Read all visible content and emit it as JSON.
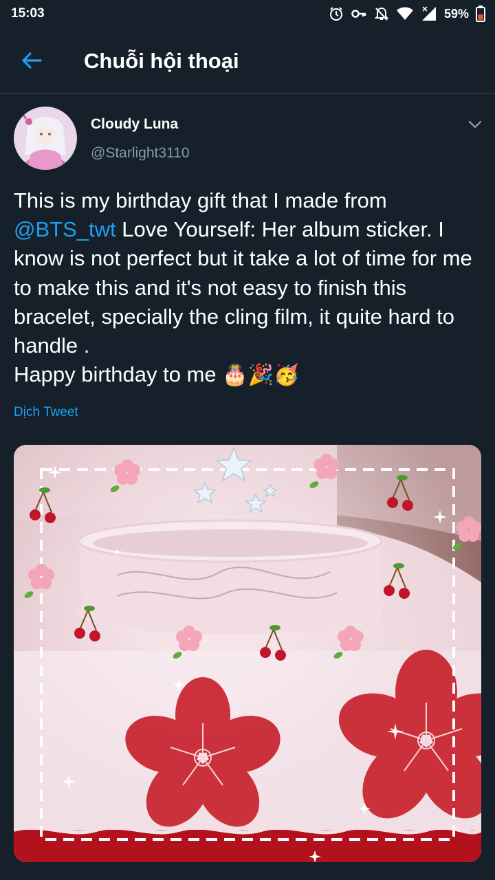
{
  "status_bar": {
    "time": "15:03",
    "battery": "59%",
    "icons": [
      "alarm-icon",
      "vpn-key-icon",
      "notifications-off-icon",
      "wifi-icon",
      "signal-icon",
      "battery-icon"
    ]
  },
  "app_bar": {
    "title": "Chuỗi hội thoại",
    "back_icon": "arrow-left-icon"
  },
  "tweet": {
    "author_name": "Cloudy Luna",
    "handle": "@Starlight3110",
    "text_part1": "This is my birthday gift that I made from\n",
    "mention": "@BTS_twt",
    "text_part2": " Love Yourself: Her album sticker. I know is not perfect but it take a lot of time for me to make this and it's not easy to finish this bracelet, specially the cling film, it quite hard to handle .\nHappy birthday to me ",
    "emojis": "🎂🎉🥳",
    "translate_label": "Dịch Tweet",
    "media_alt": "photo"
  },
  "colors": {
    "background": "#15202b",
    "accent": "#1da1f2",
    "secondary_text": "#8899a6",
    "divider": "#38444d"
  }
}
